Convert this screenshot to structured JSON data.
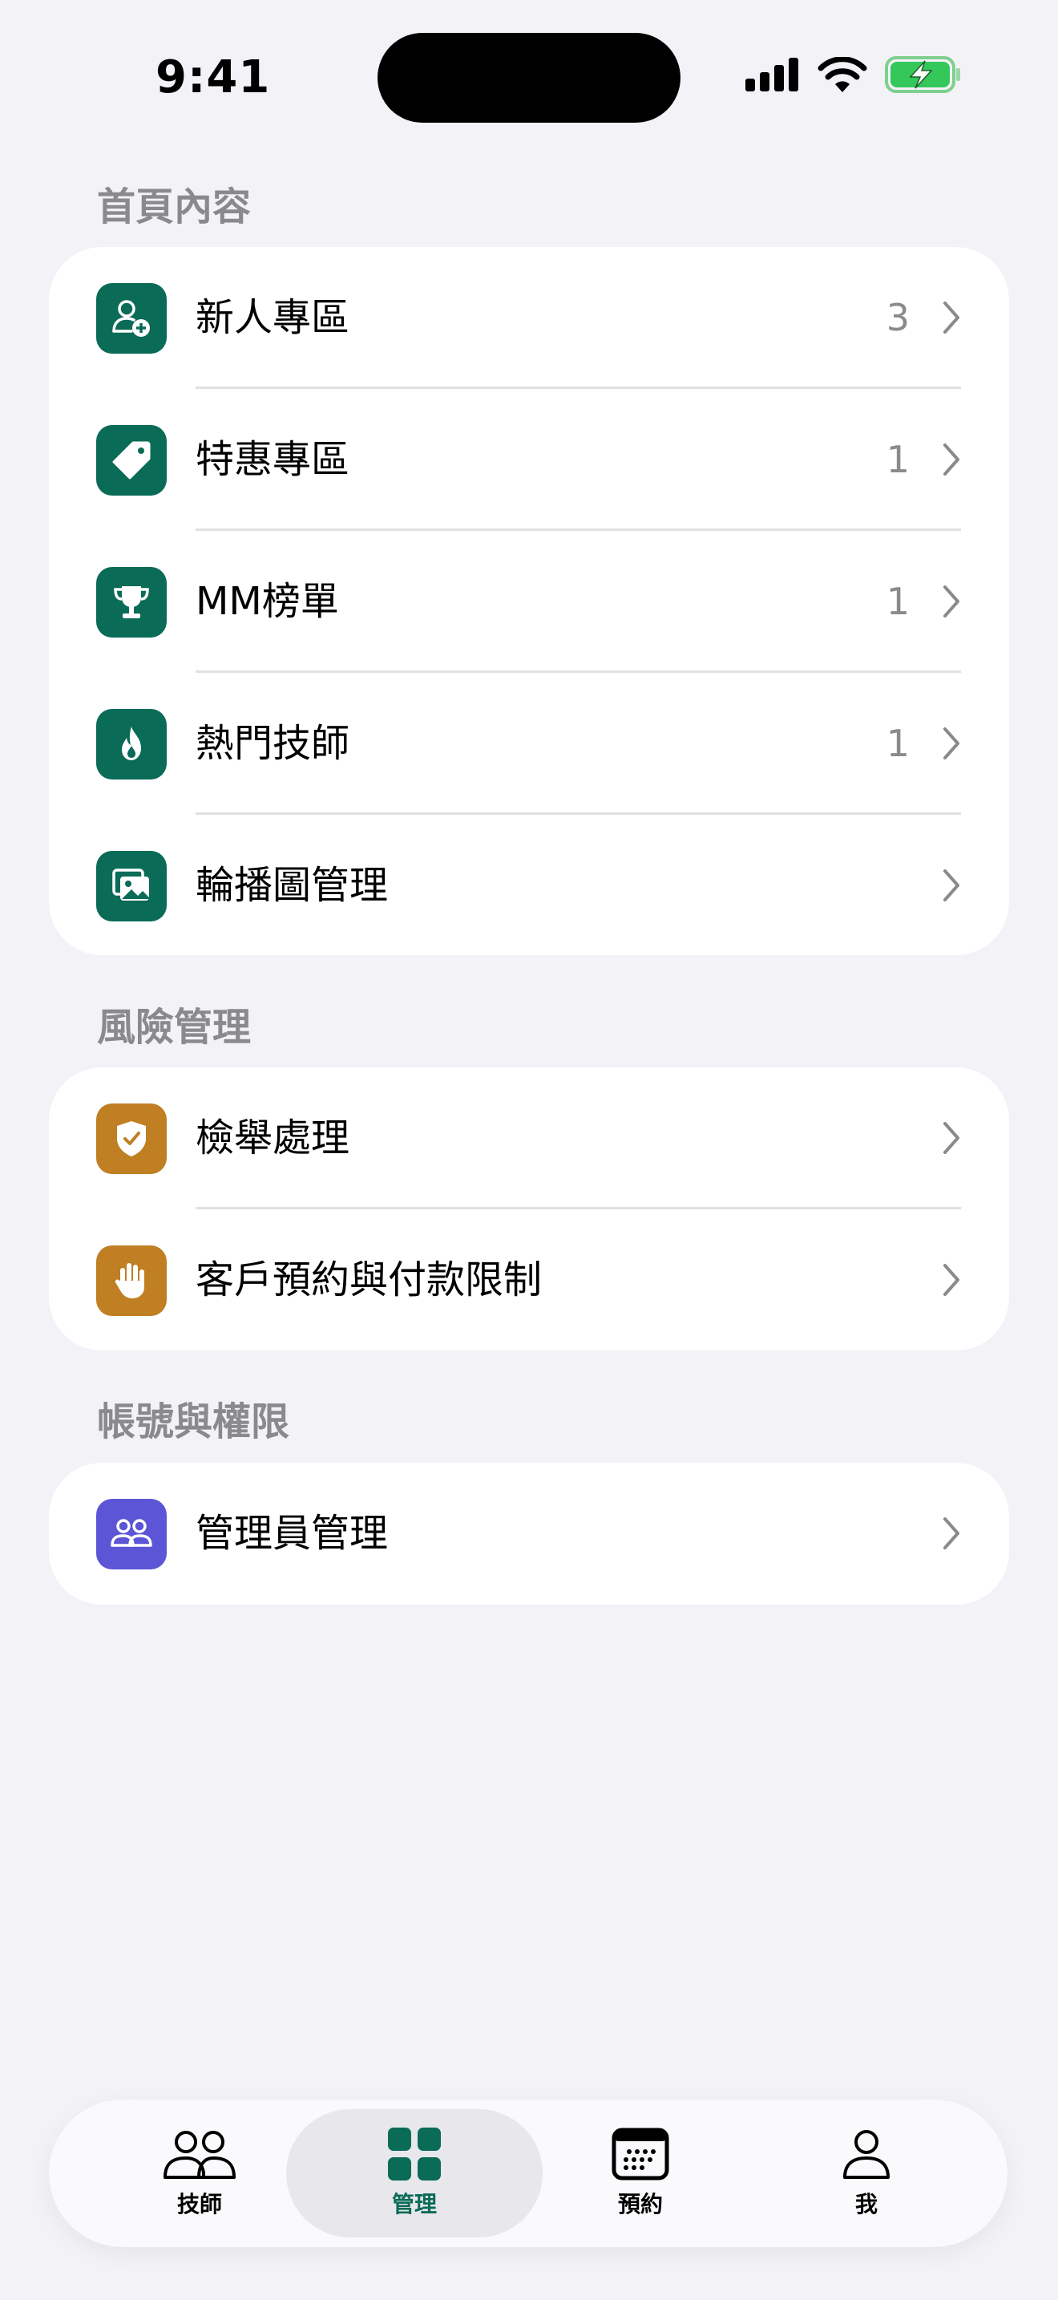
{
  "status_bar": {
    "time": "9:41"
  },
  "sections": {
    "home": {
      "title": "首頁內容",
      "items": [
        {
          "label": "新人專區",
          "count": "3",
          "icon": "person-add-icon"
        },
        {
          "label": "特惠專區",
          "count": "1",
          "icon": "tag-icon"
        },
        {
          "label": "MM榜單",
          "count": "1",
          "icon": "trophy-icon"
        },
        {
          "label": "熱門技師",
          "count": "1",
          "icon": "flame-icon"
        },
        {
          "label": "輪播圖管理",
          "count": "",
          "icon": "photo-stack-icon"
        }
      ]
    },
    "risk": {
      "title": "風險管理",
      "items": [
        {
          "label": "檢舉處理",
          "icon": "shield-check-icon"
        },
        {
          "label": "客戶預約與付款限制",
          "icon": "hand-stop-icon"
        }
      ]
    },
    "account": {
      "title": "帳號與權限",
      "items": [
        {
          "label": "管理員管理",
          "icon": "people-icon"
        }
      ]
    }
  },
  "tabbar": {
    "tabs": [
      {
        "label": "技師",
        "icon": "people-icon"
      },
      {
        "label": "管理",
        "icon": "grid-icon"
      },
      {
        "label": "預約",
        "icon": "calendar-icon"
      },
      {
        "label": "我",
        "icon": "person-icon"
      }
    ],
    "active_index": 1
  },
  "colors": {
    "green": "#0a6b57",
    "amber": "#bf7f22",
    "purple": "#5c55d6",
    "background": "#f2f2f7"
  }
}
